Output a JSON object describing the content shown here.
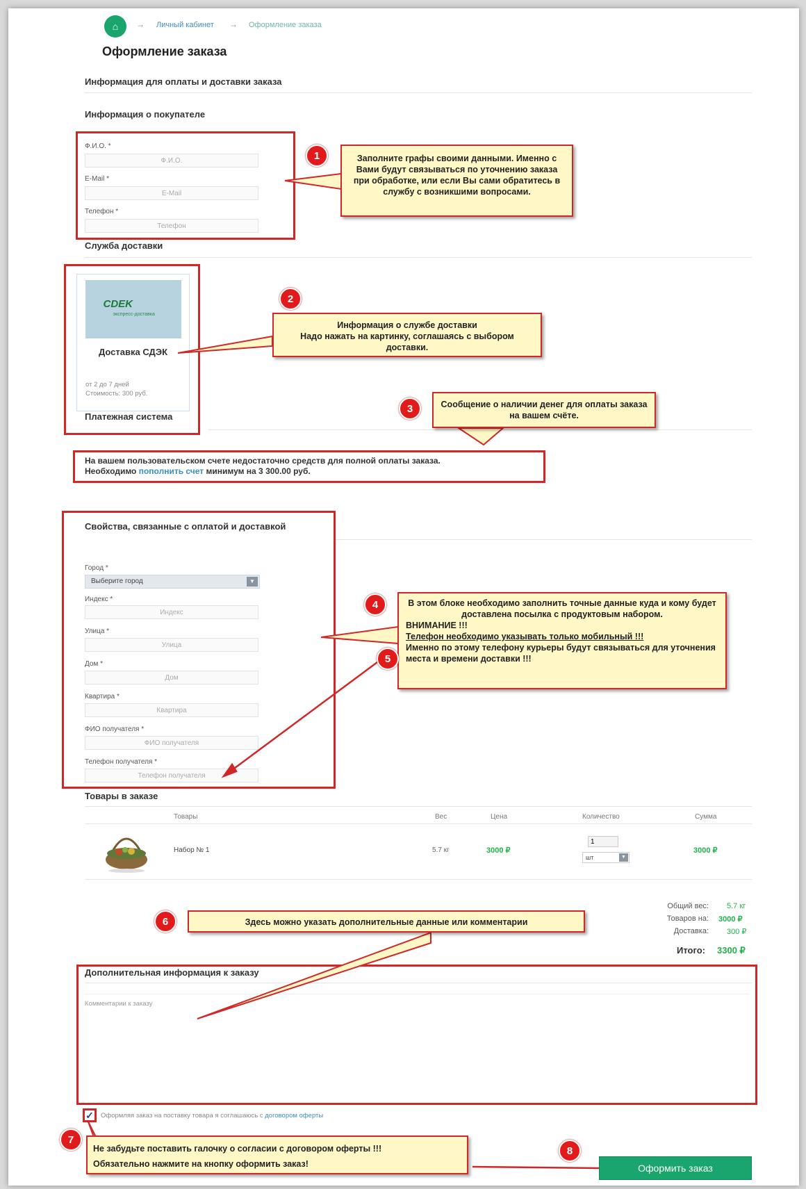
{
  "breadcrumb": {
    "home_icon": "home-icon",
    "sep": "→",
    "items": [
      "Личный кабинет",
      "Оформление заказа"
    ]
  },
  "page": {
    "title": "Оформление заказа"
  },
  "sections": {
    "payment_delivery_info": "Информация для оплаты и доставки заказа",
    "buyer_info": "Информация о покупателе",
    "delivery_service": "Служба доставки",
    "payment_system": "Платежная система",
    "properties": "Свойства, связанные с оплатой и доставкой",
    "order_items": "Товары в заказе",
    "extra_info": "Дополнительная информация к заказу"
  },
  "buyer": {
    "fio_label": "Ф.И.О. *",
    "fio_placeholder": "Ф.И.О.",
    "email_label": "E-Mail *",
    "email_placeholder": "E-Mail",
    "phone_label": "Телефон *",
    "phone_placeholder": "Телефон"
  },
  "delivery": {
    "logo_text": "CDEK",
    "logo_sub": "экспресс-доставка",
    "name": "Доставка СДЭК",
    "period": "от 2 до 7 дней",
    "cost": "Стоимость: 300 руб."
  },
  "payment": {
    "line1": "На вашем пользовательском счете недостаточно средств для полной оплаты заказа.",
    "line2_pre": "Необходимо ",
    "line2_link": "пополнить счет",
    "line2_post": " минимум на 3 300.00 руб."
  },
  "props": {
    "city_label": "Город *",
    "city_value": "Выберите город",
    "index_label": "Индекс *",
    "index_placeholder": "Индекс",
    "street_label": "Улица *",
    "street_placeholder": "Улица",
    "house_label": "Дом *",
    "house_placeholder": "Дом",
    "flat_label": "Квартира *",
    "flat_placeholder": "Квартира",
    "recipient_label": "ФИО получателя *",
    "recipient_placeholder": "ФИО получателя",
    "recphone_label": "Телефон получателя *",
    "recphone_placeholder": "Телефон получателя"
  },
  "table": {
    "headers": [
      "Товары",
      "Вес",
      "Цена",
      "Количество",
      "Сумма"
    ],
    "rows": [
      {
        "name": "Набор № 1",
        "weight": "5.7 кг",
        "price": "3000 ₽",
        "qty": "1",
        "unit": "шт",
        "sum": "3000 ₽"
      }
    ]
  },
  "summary": {
    "weight_label": "Общий вес:",
    "weight_value": "5.7 кг",
    "goods_label": "Товаров на:",
    "goods_value": "3000 ₽",
    "delivery_label": "Доставка:",
    "delivery_value": "300 ₽",
    "total_label": "Итого:",
    "total_value": "3300 ₽"
  },
  "comment": {
    "placeholder": "Комментарии к заказу"
  },
  "agree": {
    "text": "Оформляя заказ на поставку товара я соглашаюсь с ",
    "link": "договором оферты"
  },
  "order_button": "Оформить заказ",
  "notes": {
    "n1": "Заполните графы своими данными. Именно с Вами будут связываться по уточнению заказа при обработке, или если Вы сами обратитесь в службу с возникшими вопросами.",
    "n2_a": "Информация о службе доставки",
    "n2_b": "Надо нажать на картинку, соглашаясь с выбором доставки.",
    "n3": "Сообщение о наличии денег для оплаты заказа на вашем счёте.",
    "n4_a": "В этом блоке необходимо заполнить точные данные куда и кому будет доставлена посылка с продуктовым набором.",
    "n4_b": "ВНИМАНИЕ !!!",
    "n4_c": "Телефон необходимо указывать только мобильный !!!",
    "n4_d": "Именно по этому телефону курьеры будут связываться для уточнения места и времени доставки !!!",
    "n6": "Здесь можно указать дополнительные данные или комментарии",
    "n7_a": "Не забудьте поставить галочку о согласии с договором оферты !!!",
    "n7_b": "Обязательно нажмите на кнопку оформить заказ!"
  },
  "badges": [
    "1",
    "2",
    "3",
    "4",
    "5",
    "6",
    "7",
    "8"
  ],
  "colors": {
    "accent": "#1aa56d",
    "annotation_red": "#d02828",
    "note_bg": "#fff7c6",
    "price_green": "#22b14c",
    "link": "#3a8ec4"
  }
}
